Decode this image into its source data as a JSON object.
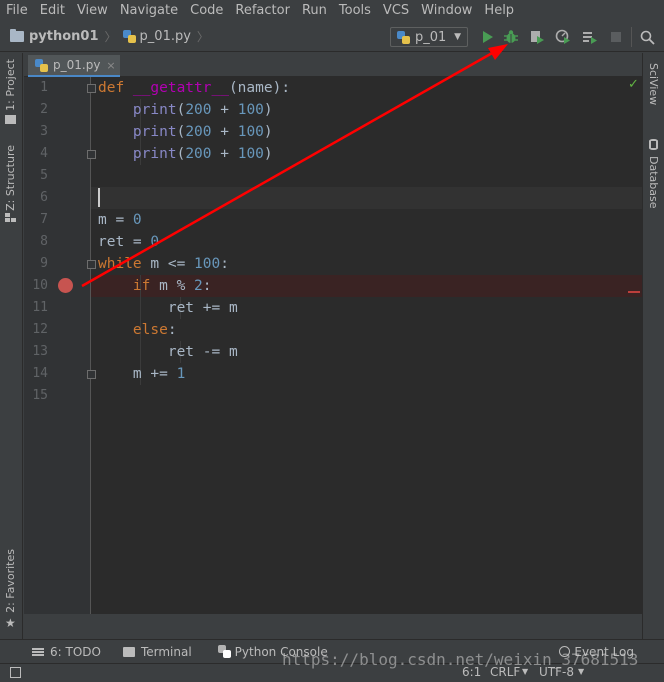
{
  "menu": [
    "File",
    "Edit",
    "View",
    "Navigate",
    "Code",
    "Refactor",
    "Run",
    "Tools",
    "VCS",
    "Window",
    "Help"
  ],
  "breadcrumb": {
    "project": "python01",
    "file": "p_01.py"
  },
  "run_config": {
    "name": "p_01"
  },
  "left_tabs": {
    "project": "1: Project",
    "structure": "Z: Structure",
    "favorites": "2: Favorites"
  },
  "right_tabs": {
    "sciview": "SciView",
    "database": "Database"
  },
  "editor_tab": {
    "label": "p_01.py",
    "close": "×"
  },
  "line_numbers": [
    "1",
    "2",
    "3",
    "4",
    "5",
    "6",
    "7",
    "8",
    "9",
    "10",
    "11",
    "12",
    "13",
    "14",
    "15"
  ],
  "code": [
    [
      {
        "t": "def ",
        "c": "kw"
      },
      {
        "t": "__getattr__",
        "c": "fn-name"
      },
      {
        "t": "(name):",
        "c": "plain"
      }
    ],
    [
      {
        "t": "    ",
        "c": "plain"
      },
      {
        "t": "print",
        "c": "builtin"
      },
      {
        "t": "(",
        "c": "plain"
      },
      {
        "t": "200",
        "c": "num"
      },
      {
        "t": " + ",
        "c": "plain"
      },
      {
        "t": "100",
        "c": "num"
      },
      {
        "t": ")",
        "c": "plain"
      }
    ],
    [
      {
        "t": "    ",
        "c": "plain"
      },
      {
        "t": "print",
        "c": "builtin"
      },
      {
        "t": "(",
        "c": "plain"
      },
      {
        "t": "200",
        "c": "num"
      },
      {
        "t": " + ",
        "c": "plain"
      },
      {
        "t": "100",
        "c": "num"
      },
      {
        "t": ")",
        "c": "plain"
      }
    ],
    [
      {
        "t": "    ",
        "c": "plain"
      },
      {
        "t": "print",
        "c": "builtin"
      },
      {
        "t": "(",
        "c": "plain"
      },
      {
        "t": "200",
        "c": "num"
      },
      {
        "t": " + ",
        "c": "plain"
      },
      {
        "t": "100",
        "c": "num"
      },
      {
        "t": ")",
        "c": "plain"
      }
    ],
    [],
    [],
    [
      {
        "t": "m = ",
        "c": "plain"
      },
      {
        "t": "0",
        "c": "num"
      }
    ],
    [
      {
        "t": "ret = ",
        "c": "plain"
      },
      {
        "t": "0",
        "c": "num"
      }
    ],
    [
      {
        "t": "while ",
        "c": "kw"
      },
      {
        "t": "m <= ",
        "c": "plain"
      },
      {
        "t": "100",
        "c": "num"
      },
      {
        "t": ":",
        "c": "plain"
      }
    ],
    [
      {
        "t": "    ",
        "c": "plain"
      },
      {
        "t": "if ",
        "c": "kw"
      },
      {
        "t": "m % ",
        "c": "plain"
      },
      {
        "t": "2",
        "c": "num"
      },
      {
        "t": ":",
        "c": "plain"
      }
    ],
    [
      {
        "t": "        ret += m",
        "c": "plain"
      }
    ],
    [
      {
        "t": "    ",
        "c": "plain"
      },
      {
        "t": "else",
        "c": "kw"
      },
      {
        "t": ":",
        "c": "plain"
      }
    ],
    [
      {
        "t": "        ret -= m",
        "c": "plain"
      }
    ],
    [
      {
        "t": "    m += ",
        "c": "plain"
      },
      {
        "t": "1",
        "c": "num"
      }
    ],
    []
  ],
  "breakpoint_line": 10,
  "caret_line": 6,
  "bottom_tools": {
    "todo": "6: TODO",
    "terminal": "Terminal",
    "python_console": "Python Console",
    "event_log": "Event Log"
  },
  "status": {
    "position": "6:1",
    "line_sep": "CRLF",
    "encoding": "UTF-8"
  },
  "watermark": "https://blog.csdn.net/weixin_37681513",
  "colors": {
    "annotation_arrow": "#ff0000",
    "breakpoint": "#c75450",
    "run_green": "#499c54"
  }
}
